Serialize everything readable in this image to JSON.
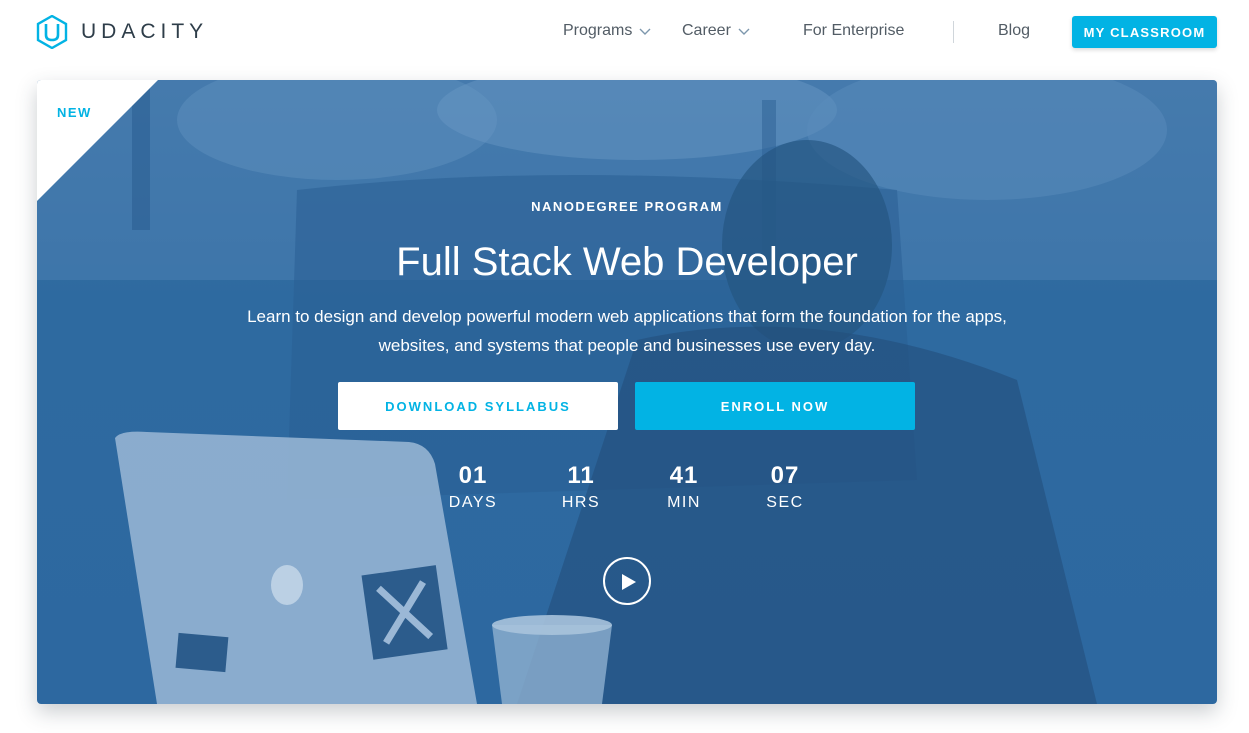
{
  "brand": {
    "name": "UDACITY",
    "color": "#02b3e4"
  },
  "nav": {
    "programs": "Programs",
    "career": "Career",
    "enterprise": "For Enterprise",
    "blog": "Blog",
    "classroom_button": "MY CLASSROOM"
  },
  "hero": {
    "badge": "NEW",
    "eyebrow": "NANODEGREE PROGRAM",
    "title": "Full Stack Web Developer",
    "description": "Learn to design and develop powerful modern web applications that form the foundation for the apps, websites, and systems that people and businesses use every day.",
    "download_button": "DOWNLOAD SYLLABUS",
    "enroll_button": "ENROLL NOW",
    "countdown": {
      "days": {
        "value": "01",
        "label": "DAYS"
      },
      "hours": {
        "value": "11",
        "label": "HRS"
      },
      "minutes": {
        "value": "41",
        "label": "MIN"
      },
      "seconds": {
        "value": "07",
        "label": "SEC"
      }
    },
    "play_icon": "play-icon"
  }
}
